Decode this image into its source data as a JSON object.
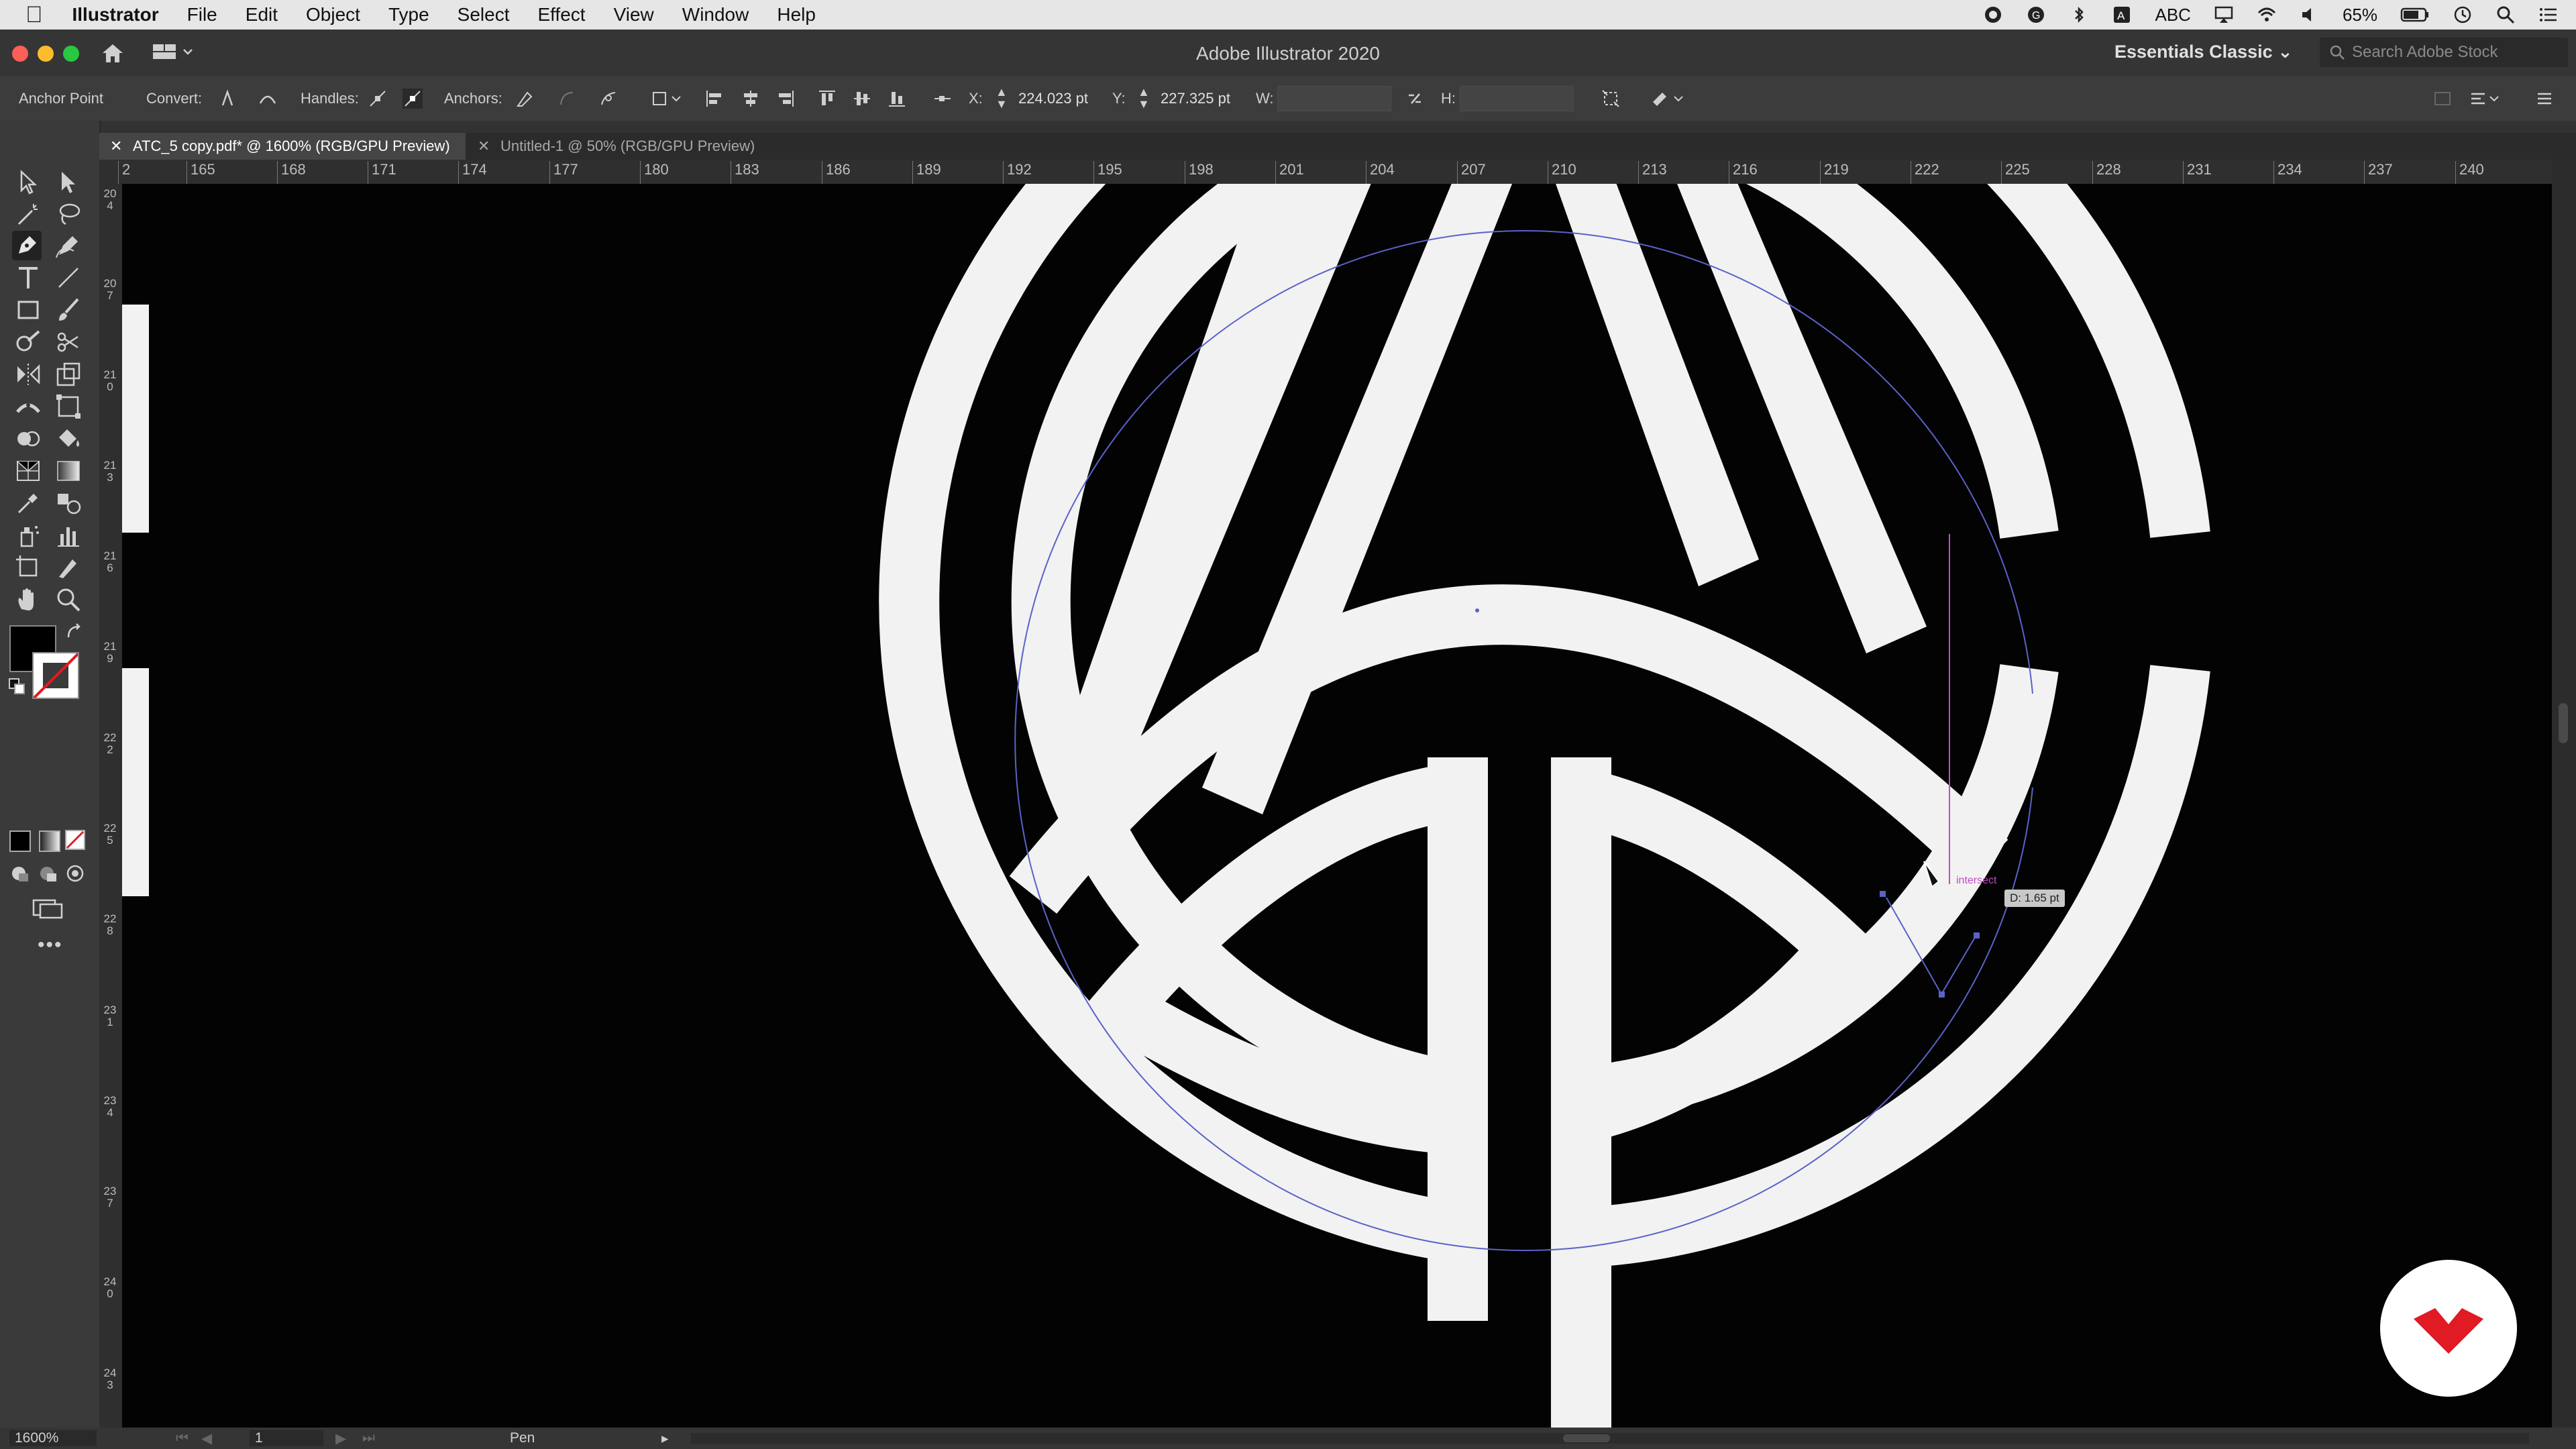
{
  "menubar": {
    "app_name": "Illustrator",
    "items": [
      "File",
      "Edit",
      "Object",
      "Type",
      "Select",
      "Effect",
      "View",
      "Window",
      "Help"
    ],
    "status": {
      "abc": "ABC",
      "battery": "65%"
    }
  },
  "window": {
    "title": "Adobe Illustrator 2020",
    "workspace": "Essentials Classic",
    "search_placeholder": "Search Adobe Stock"
  },
  "controlbar": {
    "tool_label": "Anchor Point",
    "convert_label": "Convert:",
    "handles_label": "Handles:",
    "anchors_label": "Anchors:",
    "x_label": "X:",
    "x_value": "224.023 pt",
    "y_label": "Y:",
    "y_value": "227.325 pt",
    "w_label": "W:",
    "h_label": "H:"
  },
  "tabs": [
    {
      "label": "ATC_5 copy.pdf* @ 1600% (RGB/GPU Preview)",
      "active": true
    },
    {
      "label": "Untitled-1 @ 50% (RGB/GPU Preview)",
      "active": false
    }
  ],
  "ruler": {
    "h_ticks": [
      "2",
      "165",
      "168",
      "171",
      "174",
      "177",
      "180",
      "183",
      "186",
      "189",
      "192",
      "195",
      "198",
      "201",
      "204",
      "207",
      "210",
      "213",
      "216",
      "219",
      "222",
      "225",
      "228",
      "231",
      "234",
      "237",
      "240"
    ],
    "v_ticks": [
      "204",
      "207",
      "210",
      "213",
      "216",
      "219",
      "222",
      "225",
      "228",
      "231",
      "234",
      "237",
      "240",
      "243"
    ]
  },
  "canvas": {
    "smart_guide_label": "intersect",
    "distance_tooltip": "D: 1.65 pt"
  },
  "statusbar": {
    "zoom": "1600%",
    "artboard": "1",
    "current_tool": "Pen"
  },
  "colors": {
    "artwork_fill": "#f2f2f2",
    "canvas_bg": "#030303",
    "path_stroke": "#5a62c8",
    "guide_magenta": "#c24bc2",
    "badge_red": "#e01b24"
  }
}
